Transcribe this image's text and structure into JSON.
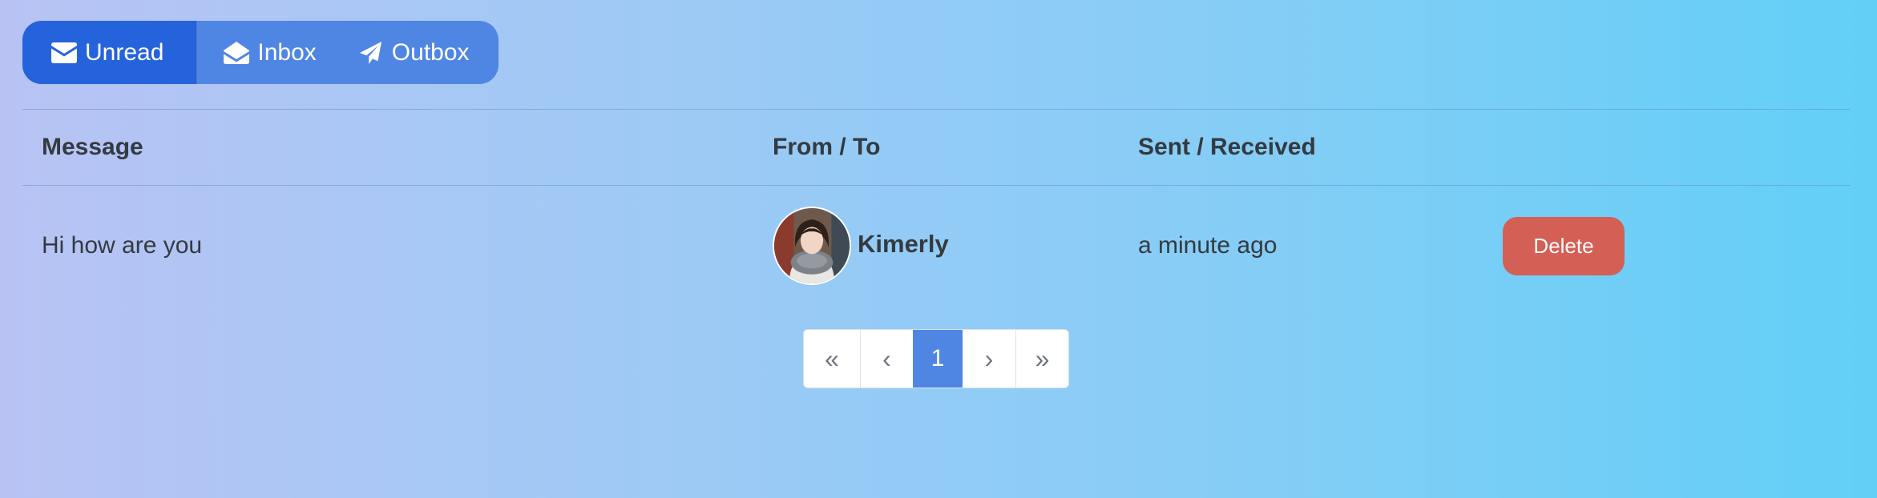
{
  "tabs": [
    {
      "label": "Unread",
      "icon": "envelope-icon",
      "active": true
    },
    {
      "label": "Inbox",
      "icon": "envelope-open-icon",
      "active": false
    },
    {
      "label": "Outbox",
      "icon": "paper-plane-icon",
      "active": false
    }
  ],
  "table": {
    "headers": [
      "Message",
      "From / To",
      "Sent / Received"
    ],
    "rows": [
      {
        "message": "Hi how are you",
        "sender": "Kimerly",
        "time": "a minute ago",
        "action_label": "Delete"
      }
    ]
  },
  "pagination": {
    "first": "«",
    "prev": "‹",
    "current": "1",
    "next": "›",
    "last": "»"
  },
  "colors": {
    "accent": "#2563dc",
    "tab_bg": "#4f86e4",
    "danger": "#d35f55",
    "page_active": "#4f86e4"
  }
}
